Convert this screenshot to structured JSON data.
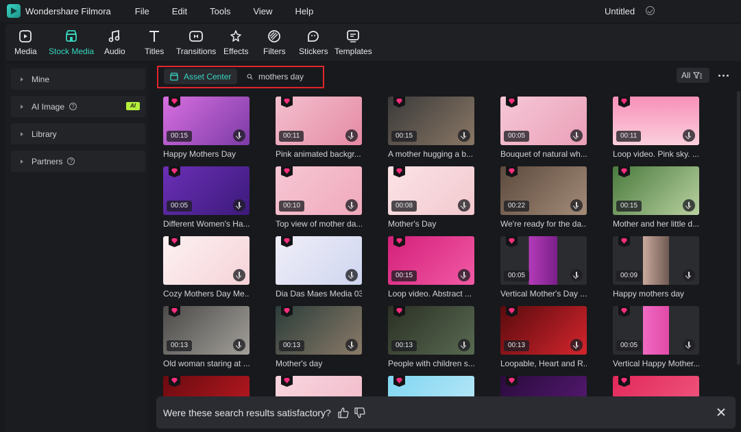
{
  "app": {
    "name": "Wondershare Filmora",
    "document_title": "Untitled",
    "accent": "#37d7c2"
  },
  "menu": [
    "File",
    "Edit",
    "Tools",
    "View",
    "Help"
  ],
  "toolbar": [
    {
      "label": "Media",
      "icon": "media-icon"
    },
    {
      "label": "Stock Media",
      "icon": "stock-media-icon",
      "active": true
    },
    {
      "label": "Audio",
      "icon": "audio-icon"
    },
    {
      "label": "Titles",
      "icon": "titles-icon"
    },
    {
      "label": "Transitions",
      "icon": "transitions-icon"
    },
    {
      "label": "Effects",
      "icon": "effects-icon"
    },
    {
      "label": "Filters",
      "icon": "filters-icon"
    },
    {
      "label": "Stickers",
      "icon": "stickers-icon"
    },
    {
      "label": "Templates",
      "icon": "templates-icon"
    }
  ],
  "sidebar": {
    "items": [
      {
        "label": "Mine"
      },
      {
        "label": "AI Image",
        "badge": "AI",
        "help": "?"
      },
      {
        "label": "Library"
      },
      {
        "label": "Partners",
        "help": "?"
      }
    ]
  },
  "main": {
    "tab_label": "Asset Center",
    "search_value": "mothers day",
    "filter_label": "All"
  },
  "results": [
    {
      "title": "Happy Mothers Day",
      "duration": "00:15"
    },
    {
      "title": "Pink animated backgr...",
      "duration": "00:11"
    },
    {
      "title": "A mother hugging a b...",
      "duration": "00:15"
    },
    {
      "title": "Bouquet of natural wh...",
      "duration": "00:05"
    },
    {
      "title": "Loop video. Pink sky. ...",
      "duration": "00:11"
    },
    {
      "title": "Different Women's Ha...",
      "duration": "00:05"
    },
    {
      "title": "Top view of mother da...",
      "duration": "00:10"
    },
    {
      "title": "Mother's Day",
      "duration": "00:08"
    },
    {
      "title": "We're ready for the da...",
      "duration": "00:22"
    },
    {
      "title": "Mother and her little d...",
      "duration": "00:15"
    },
    {
      "title": "Cozy Mothers Day Me...",
      "duration": ""
    },
    {
      "title": "Dia Das Maes Media 03",
      "duration": ""
    },
    {
      "title": "Loop video. Abstract ...",
      "duration": "00:15"
    },
    {
      "title": "Vertical Mother's Day ...",
      "duration": "00:05"
    },
    {
      "title": "Happy mothers day",
      "duration": "00:09"
    },
    {
      "title": "Old woman staring at ...",
      "duration": "00:13"
    },
    {
      "title": "Mother's day",
      "duration": "00:13"
    },
    {
      "title": "People with children s...",
      "duration": "00:13"
    },
    {
      "title": "Loopable, Heart and R...",
      "duration": "00:13"
    },
    {
      "title": "Vertical Happy Mother...",
      "duration": "00:05"
    },
    {
      "title": "",
      "duration": ""
    },
    {
      "title": "",
      "duration": ""
    },
    {
      "title": "",
      "duration": ""
    },
    {
      "title": "",
      "duration": ""
    },
    {
      "title": "",
      "duration": ""
    }
  ],
  "feedback": {
    "question": "Were these search results satisfactory?"
  }
}
